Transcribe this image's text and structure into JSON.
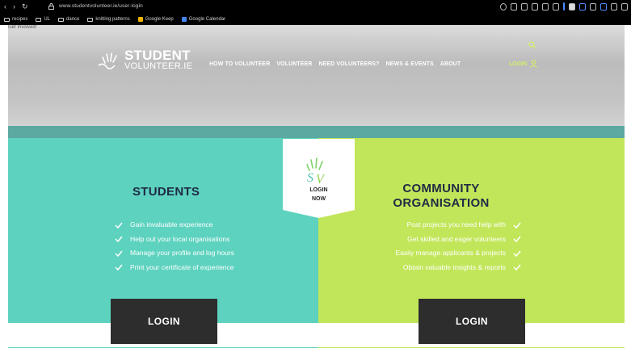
{
  "browser": {
    "url": "www.studentvolunteer.ie/user-login",
    "bookmarks": [
      {
        "label": "recipes",
        "type": "folder"
      },
      {
        "label": "UL",
        "type": "folder"
      },
      {
        "label": "dance",
        "type": "folder"
      },
      {
        "label": "knitting patterns",
        "type": "folder"
      },
      {
        "label": "Google Keep",
        "type": "app",
        "color": "#f4b400"
      },
      {
        "label": "Google Calendar",
        "type": "app",
        "color": "#4285f4"
      }
    ]
  },
  "hero": {
    "broken_image_alt": "Get Involved!",
    "logo": {
      "line1": "STUDENT",
      "line2": "VOLUNTEER.IE"
    },
    "menu": [
      "HOW TO VOLUNTEER",
      "VOLUNTEER",
      "NEED VOLUNTEERS?",
      "NEWS & EVENTS",
      "ABOUT"
    ],
    "login_label": "LOGIN",
    "accent_color": "#d4f06a"
  },
  "badge": {
    "line1": "LOGIN",
    "line2": "NOW"
  },
  "students": {
    "heading": "STUDENTS",
    "items": [
      "Gain invaluable experience",
      "Help out your local organisations",
      "Manage your profile and log hours",
      "Print your certificate of experience"
    ],
    "button": "LOGIN",
    "color": "#5dd2bf"
  },
  "community": {
    "heading_line1": "COMMUNITY",
    "heading_line2": "ORGANISATION",
    "items": [
      "Post projects you need help with",
      "Get skilled and eager volunteers",
      "Easily manage applicants & projects",
      "Obtain valuable insights & reports"
    ],
    "button": "LOGIN",
    "color": "#c2e65a"
  }
}
